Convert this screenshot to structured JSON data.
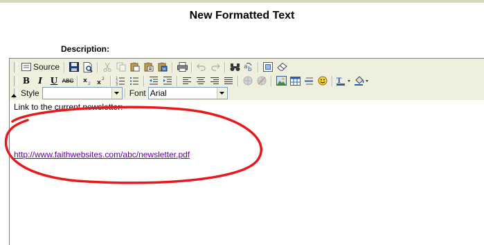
{
  "page": {
    "title": "New Formatted Text",
    "description_label": "Description:"
  },
  "toolbar": {
    "source_label": "Source",
    "style_label": "Style",
    "style_value": "",
    "font_label": "Font",
    "font_value": "Arial",
    "bold_glyph": "B",
    "italic_glyph": "I",
    "underline_glyph": "U",
    "strike_glyph": "ABC"
  },
  "editor": {
    "line1": "Link to the current newsletter:",
    "link": "http://www.faithwebsites.com/abc/newsletter.pdf"
  },
  "colors": {
    "toolbar_bg": "#efefde",
    "link": "#660099",
    "highlight_oval": "#e8191c"
  }
}
